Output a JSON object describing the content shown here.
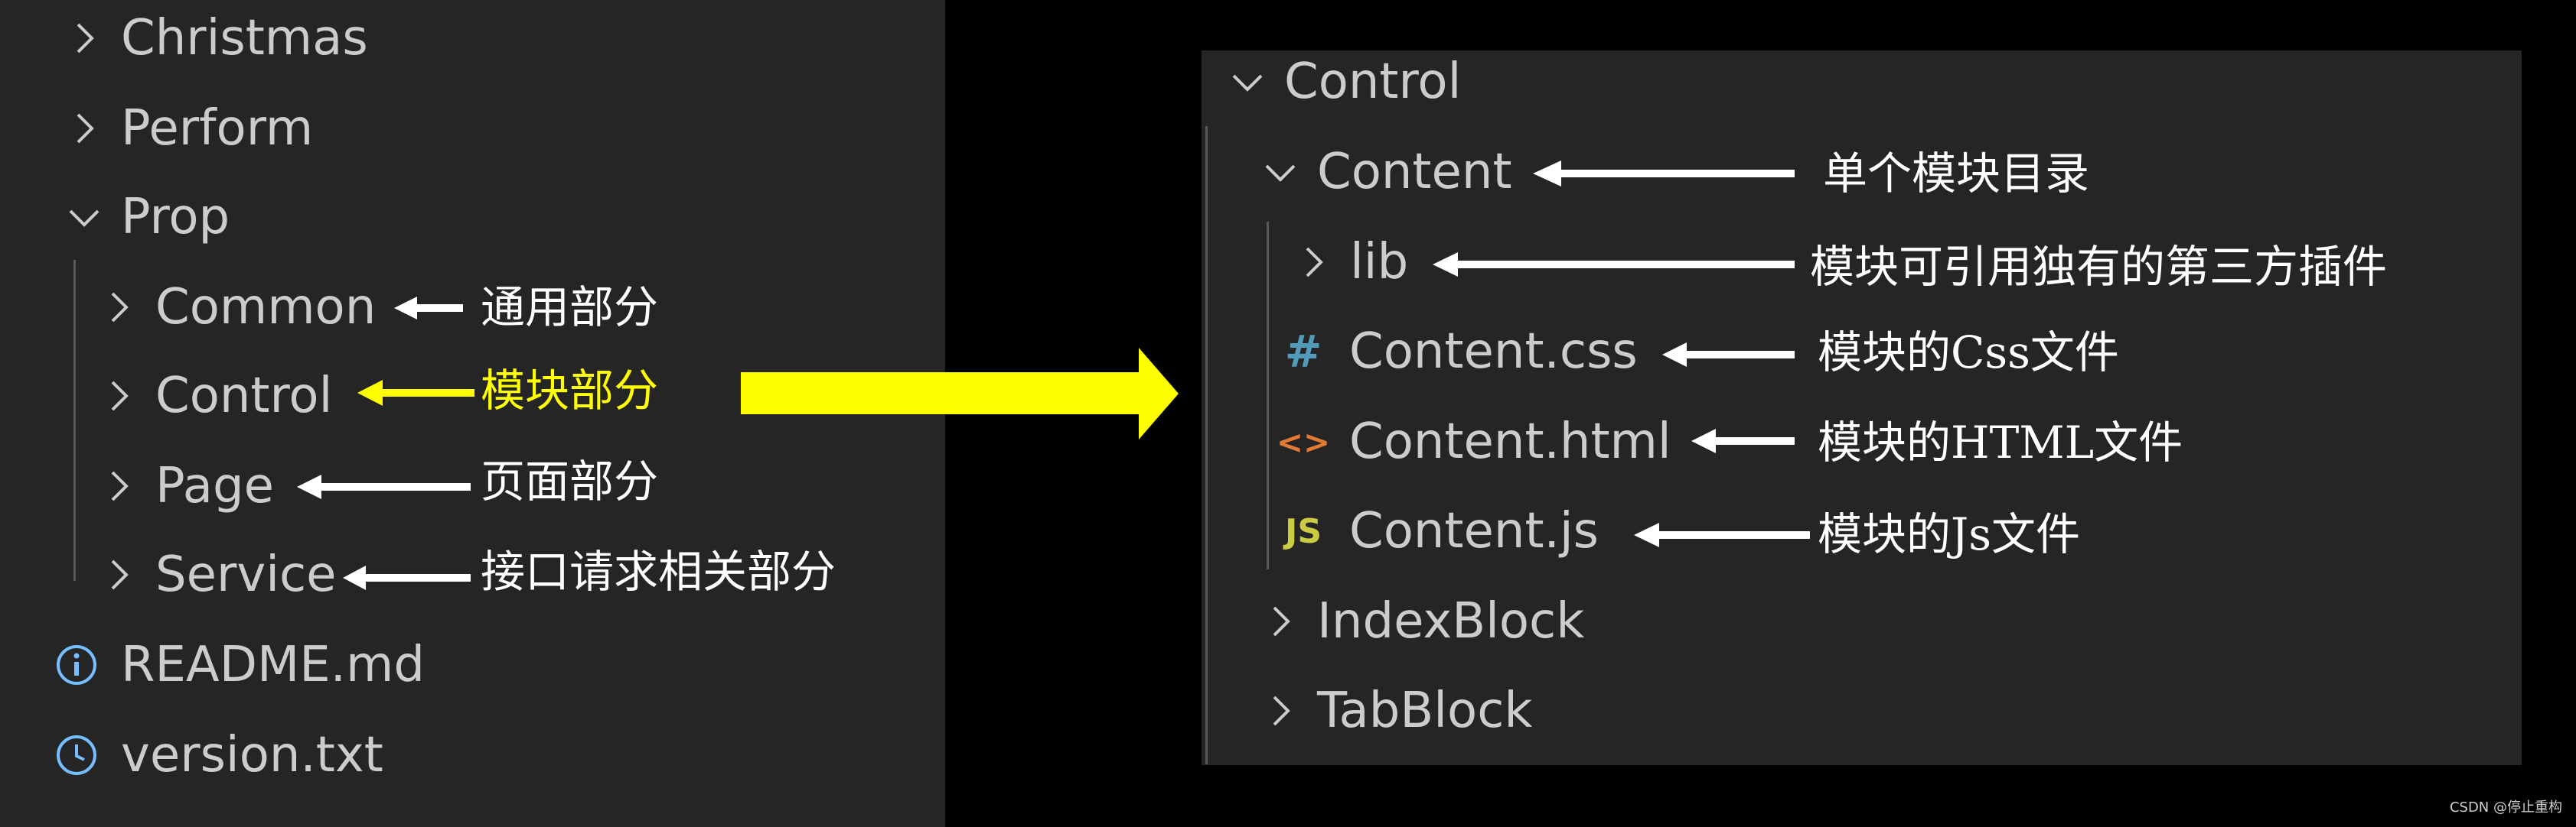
{
  "left_tree": {
    "items": [
      {
        "label": "Christmas",
        "state": "collapsed"
      },
      {
        "label": "Perform",
        "state": "collapsed"
      },
      {
        "label": "Prop",
        "state": "expanded"
      },
      {
        "label": "Common",
        "state": "collapsed"
      },
      {
        "label": "Control",
        "state": "collapsed"
      },
      {
        "label": "Page",
        "state": "collapsed"
      },
      {
        "label": "Service",
        "state": "collapsed"
      },
      {
        "label": "README.md",
        "icon": "info-icon"
      },
      {
        "label": "version.txt",
        "icon": "clock-icon"
      }
    ]
  },
  "left_annotations": {
    "common": "通用部分",
    "control": "模块部分",
    "page": "页面部分",
    "service": "接口请求相关部分"
  },
  "right_tree": {
    "items": [
      {
        "label": "Control",
        "state": "expanded"
      },
      {
        "label": "Content",
        "state": "expanded"
      },
      {
        "label": "lib",
        "state": "collapsed"
      },
      {
        "label": "Content.css",
        "icon": "css-hash-icon",
        "icon_text": "#"
      },
      {
        "label": "Content.html",
        "icon": "html-brackets-icon",
        "icon_text": "<>"
      },
      {
        "label": "Content.js",
        "icon": "js-icon",
        "icon_text": "JS"
      },
      {
        "label": "IndexBlock",
        "state": "collapsed"
      },
      {
        "label": "TabBlock",
        "state": "collapsed"
      }
    ]
  },
  "right_annotations": {
    "content": "单个模块目录",
    "lib": "模块可引用独有的第三方插件",
    "css": "模块的Css文件",
    "html": "模块的HTML文件",
    "js": "模块的Js文件"
  },
  "credit": "CSDN @停止重构",
  "colors": {
    "background": "#000000",
    "panel": "#252526",
    "text": "#cccccc",
    "annotation": "#ffffff",
    "highlight": "#ffff00",
    "css_icon": "#519aba",
    "html_icon": "#e37933",
    "js_icon": "#cbcb41",
    "info_icon": "#75beff"
  }
}
